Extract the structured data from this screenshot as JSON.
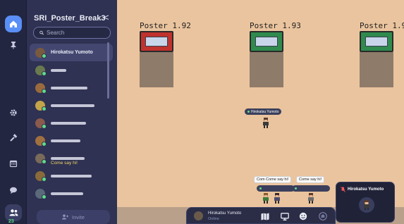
{
  "sidebar": {
    "space_title": "SRI_Poster_Break3",
    "collapse_glyph": "<",
    "search_placeholder": "Search",
    "invite_label": "Invite",
    "online_count": "23",
    "users": [
      {
        "name": "Hirokatsu Yumoto",
        "active": true,
        "avatar_color": "#7a5a3e",
        "status": ""
      },
      {
        "name": "",
        "active": false,
        "avatar_color": "#6a7a4e",
        "status": ""
      },
      {
        "name": "",
        "active": false,
        "avatar_color": "#9a6a3e",
        "status": ""
      },
      {
        "name": "",
        "active": false,
        "avatar_color": "#c4a44a",
        "status": ""
      },
      {
        "name": "",
        "active": false,
        "avatar_color": "#8a5a4e",
        "status": ""
      },
      {
        "name": "",
        "active": false,
        "avatar_color": "#a07040",
        "status": ""
      },
      {
        "name": "",
        "active": false,
        "avatar_color": "#7a6a5a",
        "status": "Come say hi!"
      },
      {
        "name": "",
        "active": false,
        "avatar_color": "#8a6a3a",
        "status": ""
      },
      {
        "name": "",
        "active": false,
        "avatar_color": "#5a6a7a",
        "status": ""
      }
    ]
  },
  "rail": {
    "icons": [
      "home-icon",
      "pin-icon",
      "settings-icon",
      "build-icon",
      "calendar-icon",
      "chat-icon",
      "people-icon"
    ]
  },
  "map": {
    "posters": [
      {
        "label": "Poster 1.92",
        "frame_color": "#c0322e"
      },
      {
        "label": "Poster 1.93",
        "frame_color": "#2f8a4e"
      },
      {
        "label": "Poster 1.9",
        "frame_color": "#2f8a4e"
      }
    ],
    "player_tag": "Hirokatsu Yumoto",
    "bubbles": [
      "Com Come say hi!",
      "Come say hi!"
    ]
  },
  "dock": {
    "name": "Hirokatsu Yumoto",
    "status": "Online",
    "icons": [
      "map-icon",
      "pin-board-icon",
      "screen-share-icon",
      "emoji-icon",
      "hand-icon"
    ]
  },
  "card": {
    "name": "Hirokatsu Yumoto"
  },
  "colors": {
    "accent": "#5a8ff7",
    "online": "#5fdc8a",
    "status_text": "#f2d36b",
    "floor": "#eac49e"
  }
}
